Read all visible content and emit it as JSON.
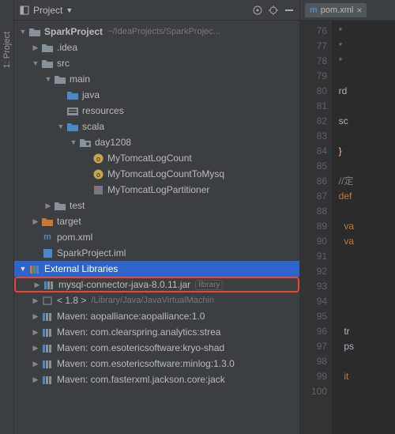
{
  "sidetab": "1: Project",
  "toolbar": {
    "dropdown": "Project"
  },
  "tree": {
    "root": {
      "name": "SparkProject",
      "path": "~/IdeaProjects/SparkProjec..."
    },
    "idea": ".idea",
    "src": "src",
    "main": "main",
    "java": "java",
    "resources": "resources",
    "scala": "scala",
    "day1208": "day1208",
    "f1": "MyTomcatLogCount",
    "f2": "MyTomcatLogCountToMysq",
    "f3": "MyTomcatLogPartitioner",
    "test": "test",
    "target": "target",
    "pom": "pom.xml",
    "iml": "SparkProject.iml",
    "extlib": "External Libraries",
    "mysql": "mysql-connector-java-8.0.11.jar",
    "mysql_tag": "library",
    "jdk": "< 1.8 >",
    "jdk_path": "/Library/Java/JavaVirtualMachin",
    "m1": "Maven: aopalliance:aopalliance:1.0",
    "m2": "Maven: com.clearspring.analytics:strea",
    "m3": "Maven: com.esotericsoftware:kryo-shad",
    "m4": "Maven: com.esotericsoftware:minlog:1.3.0",
    "m5": "Maven: com.fasterxml.jackson.core:jack"
  },
  "editor": {
    "tab": "pom.xml",
    "lines": [
      76,
      77,
      78,
      79,
      80,
      81,
      82,
      83,
      84,
      85,
      86,
      87,
      88,
      89,
      90,
      91,
      92,
      93,
      94,
      95,
      96,
      97,
      98,
      99,
      100
    ],
    "code": [
      {
        "t": "cmt",
        "v": "  *"
      },
      {
        "t": "cmt",
        "v": "  *"
      },
      {
        "t": "cmt",
        "v": "  *"
      },
      {
        "t": "blank",
        "v": ""
      },
      {
        "t": "id",
        "v": "  rd"
      },
      {
        "t": "blank",
        "v": ""
      },
      {
        "t": "id",
        "v": "  sc"
      },
      {
        "t": "blank",
        "v": ""
      },
      {
        "t": "brace",
        "v": "  }"
      },
      {
        "t": "blank",
        "v": ""
      },
      {
        "t": "cmt",
        "v": "  //定"
      },
      {
        "t": "kw",
        "v": "  def "
      },
      {
        "t": "blank",
        "v": ""
      },
      {
        "t": "kw",
        "v": "    va"
      },
      {
        "t": "kw",
        "v": "    va"
      },
      {
        "t": "blank",
        "v": ""
      },
      {
        "t": "blank",
        "v": ""
      },
      {
        "t": "blank",
        "v": ""
      },
      {
        "t": "blank",
        "v": ""
      },
      {
        "t": "blank",
        "v": ""
      },
      {
        "t": "id",
        "v": "    tr"
      },
      {
        "t": "id",
        "v": "    ps"
      },
      {
        "t": "blank",
        "v": ""
      },
      {
        "t": "kw",
        "v": "    it"
      },
      {
        "t": "blank",
        "v": ""
      }
    ]
  }
}
